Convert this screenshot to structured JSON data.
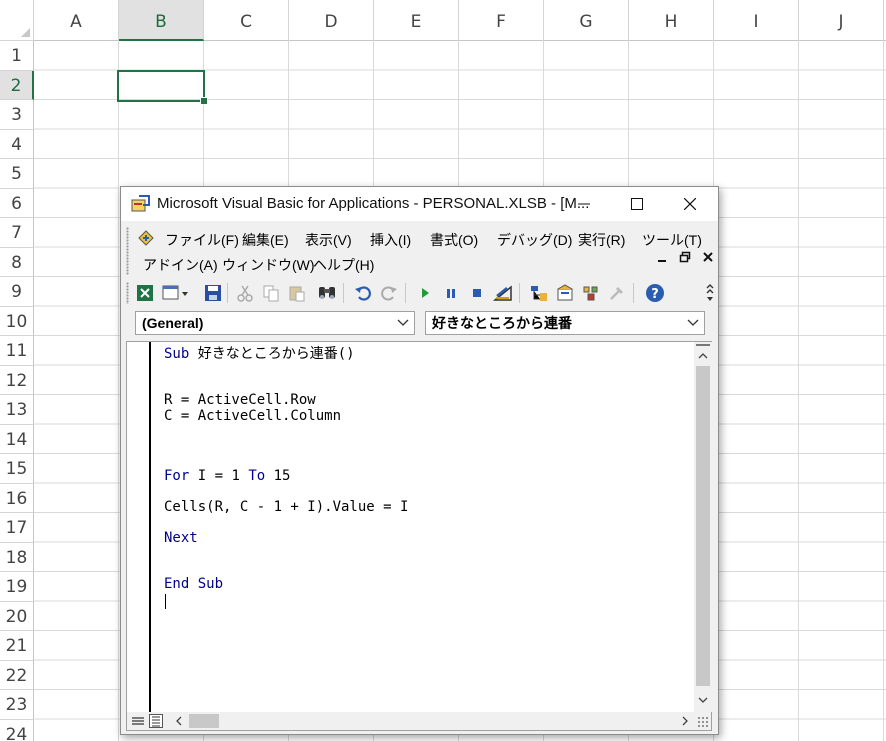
{
  "sheet": {
    "columns": [
      "A",
      "B",
      "C",
      "D",
      "E",
      "F",
      "G",
      "H",
      "I",
      "J"
    ],
    "rows": [
      "1",
      "2",
      "3",
      "4",
      "5",
      "6",
      "7",
      "8",
      "9",
      "10",
      "11",
      "12",
      "13",
      "14",
      "15",
      "16",
      "17",
      "18",
      "19",
      "20",
      "21",
      "22",
      "23",
      "24"
    ],
    "selected_column": "B",
    "selected_row": "2"
  },
  "vbe": {
    "title": "Microsoft Visual Basic for Applications - PERSONAL.XLSB - [M...",
    "menu": {
      "row1": [
        "ファイル(F)",
        "編集(E)",
        "表示(V)",
        "挿入(I)",
        "書式(O)",
        "デバッグ(D)",
        "実行(R)",
        "ツール(T)"
      ],
      "row2": [
        "アドイン(A)",
        "ウィンドウ(W)",
        "ヘルプ(H)"
      ]
    },
    "object_dropdown": "(General)",
    "procedure_dropdown": "好きなところから連番",
    "code": [
      {
        "kw": "Sub",
        "text": " 好きなところから連番()"
      },
      {
        "kw": "",
        "text": ""
      },
      {
        "kw": "",
        "text": "R = ActiveCell.Row"
      },
      {
        "kw": "",
        "text": "C = ActiveCell.Column"
      },
      {
        "kw": "",
        "text": ""
      },
      {
        "kw": "For",
        "text": " I = 1 "
      },
      {
        "kw": "",
        "text": "Cells(R, C - 1 + I).Value = I"
      },
      {
        "kw": "Next",
        "text": ""
      },
      {
        "kw": "End Sub",
        "text": ""
      }
    ],
    "for_to_keyword": "To",
    "for_to_value": " 15",
    "icons": {
      "logo": "vba-logo-icon",
      "excel": "excel-view-icon",
      "insert": "insert-userform-icon",
      "save": "save-icon",
      "cut": "cut-icon",
      "copy": "copy-icon",
      "paste": "paste-icon",
      "find": "find-icon",
      "undo": "undo-icon",
      "redo": "redo-icon",
      "run": "run-icon",
      "break": "break-icon",
      "reset": "reset-icon",
      "design": "design-mode-icon",
      "project": "project-explorer-icon",
      "properties": "properties-icon",
      "object_browser": "object-browser-icon",
      "toolbox": "toolbox-icon",
      "help": "help-icon"
    }
  }
}
